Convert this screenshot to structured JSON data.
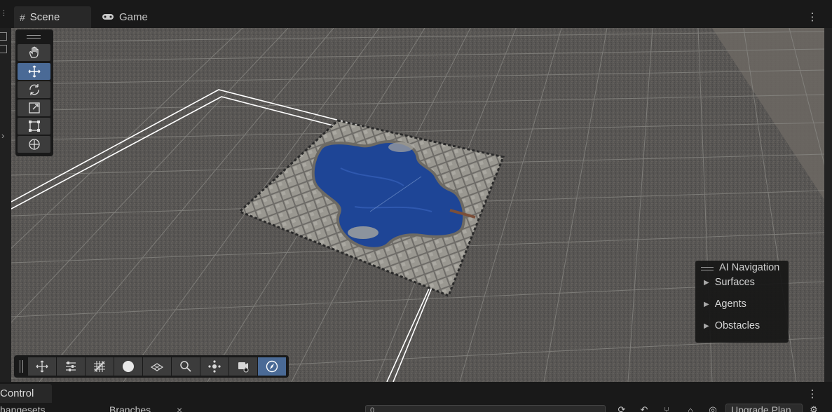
{
  "tabs": [
    {
      "label": "Scene",
      "icon": "grid-hash-icon",
      "active": true
    },
    {
      "label": "Game",
      "icon": "gamepad-icon",
      "active": false
    }
  ],
  "tools": [
    {
      "name": "hand-tool",
      "active": false
    },
    {
      "name": "move-tool",
      "active": true
    },
    {
      "name": "rotate-tool",
      "active": false
    },
    {
      "name": "scale-tool",
      "active": false
    },
    {
      "name": "rect-tool",
      "active": false
    },
    {
      "name": "transform-tool",
      "active": false
    }
  ],
  "overlay_toolbar": [
    {
      "name": "move-gizmo-icon",
      "active": false
    },
    {
      "name": "sliders-icon",
      "active": false
    },
    {
      "name": "grid-snap-icon",
      "active": false
    },
    {
      "name": "sphere-icon",
      "active": false
    },
    {
      "name": "surface-icon",
      "active": false
    },
    {
      "name": "magnifier-icon",
      "active": false
    },
    {
      "name": "pivot-icon",
      "active": false
    },
    {
      "name": "camera-icon",
      "active": false
    },
    {
      "name": "compass-icon",
      "active": true
    }
  ],
  "ai_navigation": {
    "title": "AI Navigation",
    "items": [
      "Surfaces",
      "Agents",
      "Obstacles"
    ]
  },
  "bottom_panel": {
    "tab": "Control",
    "subtabs": [
      "hangesets",
      "Branches"
    ],
    "search_value": "0",
    "upgrade_label": "Upgrade Plan"
  },
  "colors": {
    "accent": "#4a6a96",
    "water": "#1e4596",
    "tile": "#8c8a84",
    "ground": "#575654"
  }
}
